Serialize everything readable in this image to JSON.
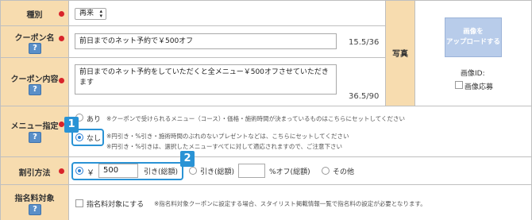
{
  "rows": {
    "type": {
      "label": "種別",
      "select_value": "再来"
    },
    "coupon_name": {
      "label": "クーポン名",
      "value": "前日までのネット予約で￥500オフ",
      "count": "15.5/36"
    },
    "coupon_content": {
      "label": "クーポン内容",
      "value": "前日までのネット予約をしていただくと全メニュー￥500オフさせていただきます",
      "count": "36.5/90"
    },
    "menu": {
      "label": "メニュー指定",
      "option_yes": "あり",
      "option_yes_note": "※クーポンで受けられるメニュー（コース）・価格・施術時間が決まっているものはこちらにセットしてください",
      "option_no": "なし",
      "note1": "※円引き・%引き・施術時間のぶれのないプレゼントなどは、こちらにセットしてください",
      "note2": "※円引き・%引きは、選択したメニューすべてに対して適応されますので、ご注意下さい"
    },
    "discount": {
      "label": "割引方法",
      "currency": "￥",
      "amount": "500",
      "yen_label": "引き(総額)",
      "pct_prefix": "引き(総額)",
      "pct_suffix": "%オフ(総額)",
      "other": "その他"
    },
    "nominee": {
      "label": "指名料対象",
      "checkbox_label": "指名料対象にする",
      "note": "※指名料対象クーポンに設定する場合、スタイリスト掲載情報一覧で指名料の設定が必要となります。"
    }
  },
  "photo": {
    "label": "写真",
    "upload_button": "画像を\nアップロードする",
    "image_id_label": "画像ID:",
    "image_apply_label": "画像応募"
  },
  "help_icon": "?",
  "callouts": [
    "1",
    "2"
  ],
  "colors": {
    "label_bg": "#f7dcaf",
    "accent": "#2a93d5",
    "required_dot": "#d8232a",
    "help_button": "#5a8fc8"
  }
}
